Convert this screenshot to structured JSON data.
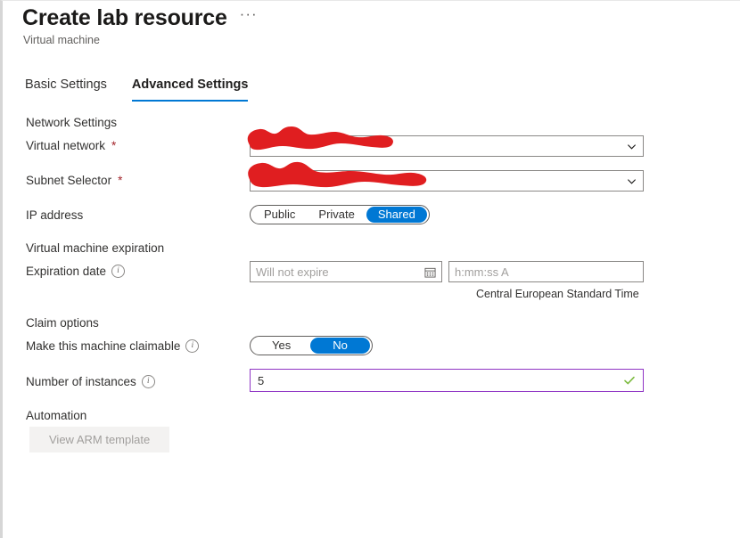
{
  "header": {
    "title": "Create lab resource",
    "subtitle": "Virtual machine",
    "more_label": "···"
  },
  "tabs": [
    {
      "label": "Basic Settings",
      "active": false
    },
    {
      "label": "Advanced Settings",
      "active": true
    }
  ],
  "sections": {
    "network": {
      "heading": "Network Settings",
      "virtual_network": {
        "label": "Virtual network",
        "required_marker": "*",
        "value": "",
        "redacted": true
      },
      "subnet_selector": {
        "label": "Subnet Selector",
        "required_marker": "*",
        "value": "",
        "redacted": true
      },
      "ip_address": {
        "label": "IP address",
        "options": [
          "Public",
          "Private",
          "Shared"
        ],
        "selected": "Shared"
      }
    },
    "expiration": {
      "heading": "Virtual machine expiration",
      "expiration_date": {
        "label": "Expiration date",
        "date_placeholder": "Will not expire",
        "date_value": "",
        "time_placeholder": "h:mm:ss A",
        "time_value": "",
        "timezone": "Central European Standard Time"
      }
    },
    "claim": {
      "heading": "Claim options",
      "claimable": {
        "label": "Make this machine claimable",
        "options": [
          "Yes",
          "No"
        ],
        "selected": "No"
      },
      "instances": {
        "label": "Number of instances",
        "value": "5",
        "valid": true
      }
    },
    "automation": {
      "heading": "Automation",
      "view_arm_template_label": "View ARM template",
      "disabled": true
    }
  },
  "colors": {
    "accent_blue": "#0078d4",
    "required_red": "#a4262c",
    "redaction_red": "#e01e20",
    "valid_green": "#7cbb3f",
    "input_purple": "#8f34c4",
    "disabled_bg": "#f3f2f1",
    "disabled_text": "#a19f9d"
  }
}
